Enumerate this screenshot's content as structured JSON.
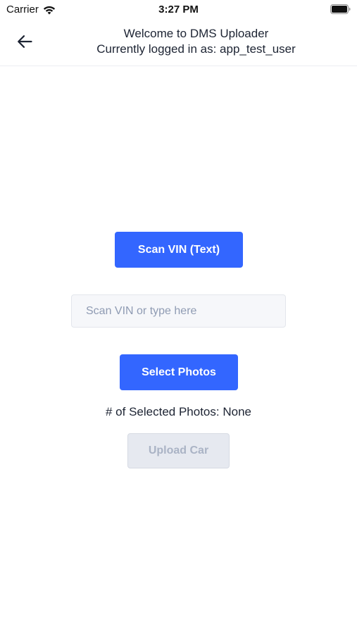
{
  "status_bar": {
    "carrier": "Carrier",
    "time": "3:27 PM"
  },
  "header": {
    "title_line1": "Welcome to DMS Uploader",
    "title_line2": "Currently logged in as: app_test_user"
  },
  "main": {
    "scan_button_label": "Scan VIN (Text)",
    "vin_input": {
      "value": "",
      "placeholder": "Scan VIN or type here"
    },
    "select_photos_label": "Select Photos",
    "selected_photos_text": "# of Selected Photos: None",
    "upload_button_label": "Upload Car"
  },
  "colors": {
    "primary": "#3366ff",
    "disabled_bg": "#e6e9f0",
    "disabled_text": "#aab3c5"
  },
  "icons": {
    "back": "arrow-left-icon",
    "wifi": "wifi-icon",
    "battery": "battery-icon"
  }
}
